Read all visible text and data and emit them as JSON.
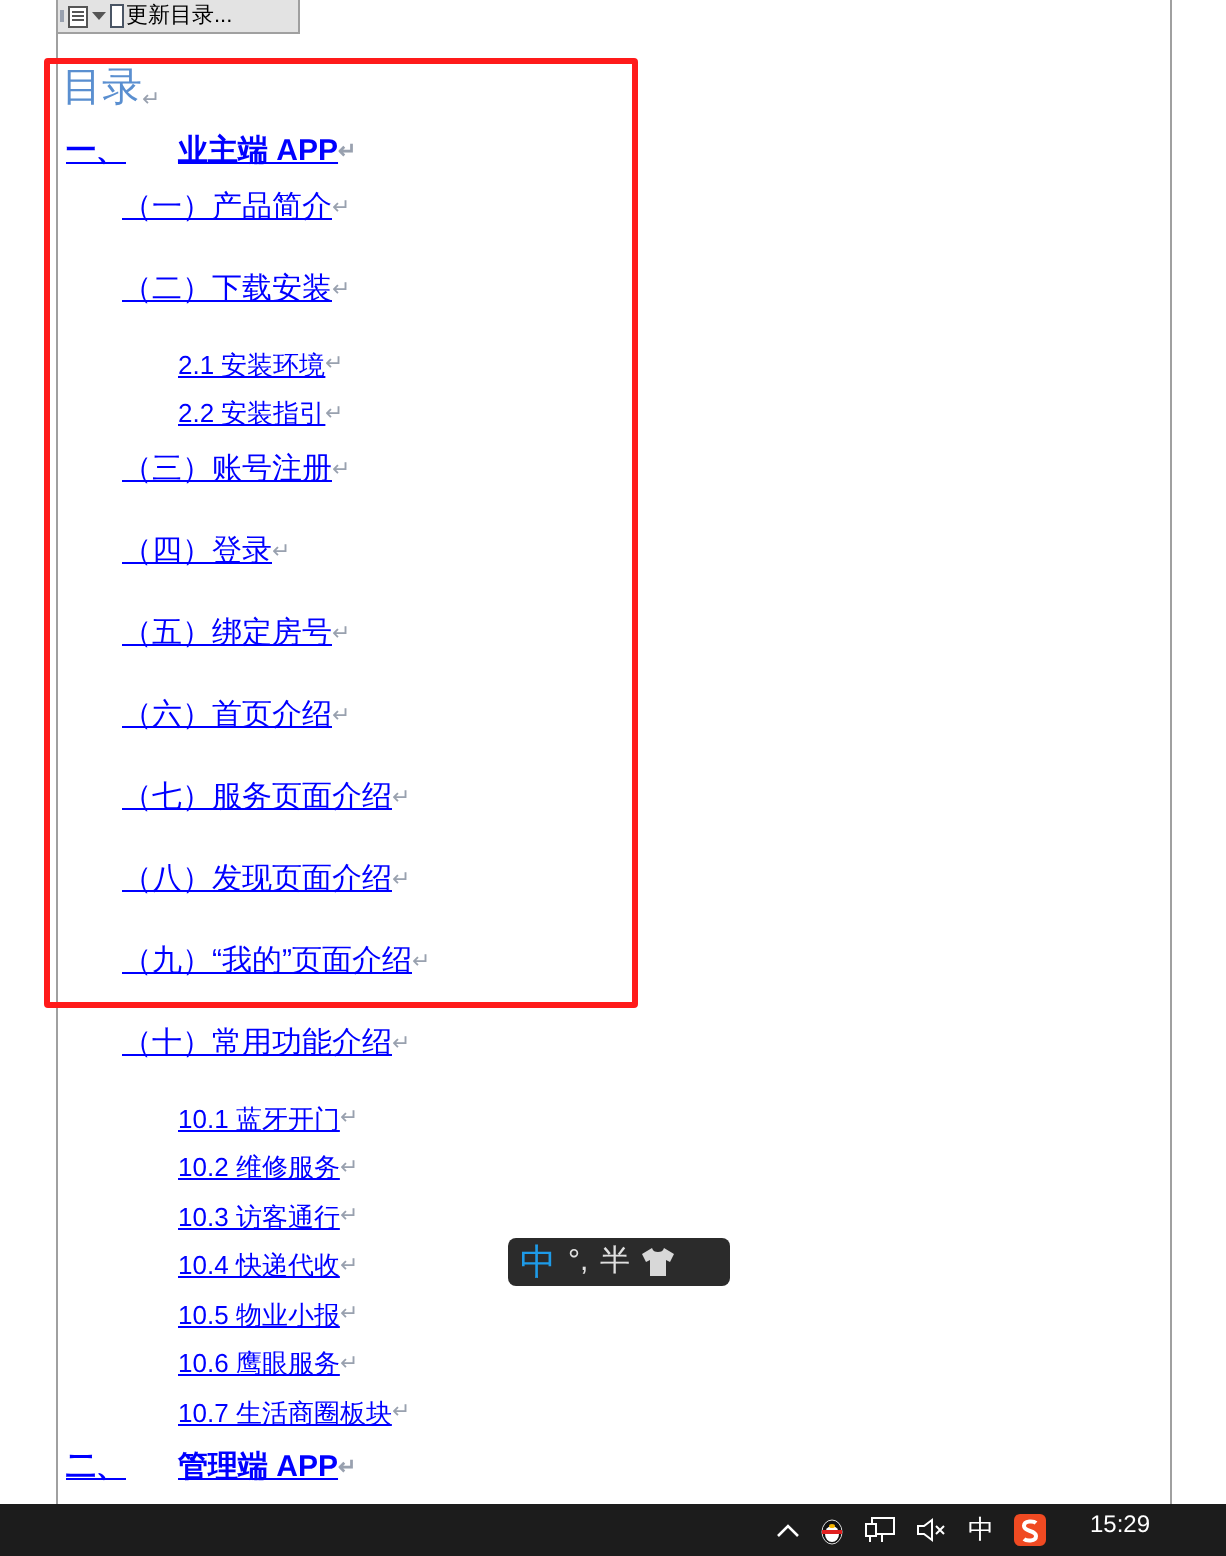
{
  "toolbar": {
    "button": "更新目录..."
  },
  "heading": {
    "text": "目录",
    "mark": "↵"
  },
  "entries": [
    {
      "kind": "level1",
      "number": "一、",
      "text": "业主端 APP",
      "mark": "↵"
    },
    {
      "kind": "level2",
      "text": "（一）产品简介",
      "mark": "↵"
    },
    {
      "kind": "level2",
      "text": "（二）下载安装",
      "mark": "↵"
    },
    {
      "kind": "level3",
      "text": "2.1 安装环境",
      "mark": "↵"
    },
    {
      "kind": "level3",
      "text": "2.2 安装指引",
      "mark": "↵"
    },
    {
      "kind": "level2",
      "text": "（三）账号注册",
      "mark": "↵"
    },
    {
      "kind": "level2",
      "text": "（四）登录",
      "mark": "↵"
    },
    {
      "kind": "level2",
      "text": "（五）绑定房号",
      "mark": "↵"
    },
    {
      "kind": "level2",
      "text": "（六）首页介绍",
      "mark": "↵"
    },
    {
      "kind": "level2",
      "text": "（七）服务页面介绍",
      "mark": "↵"
    },
    {
      "kind": "level2",
      "text": "（八）发现页面介绍",
      "mark": "↵"
    },
    {
      "kind": "level2",
      "text": "（九）“我的”页面介绍",
      "mark": "↵"
    },
    {
      "kind": "level2",
      "text": "（十）常用功能介绍",
      "mark": "↵"
    },
    {
      "kind": "level3",
      "text": "10.1 蓝牙开门",
      "mark": "↵"
    },
    {
      "kind": "level3",
      "text": "10.2 维修服务",
      "mark": "↵"
    },
    {
      "kind": "level3",
      "text": "10.3 访客通行",
      "mark": "↵"
    },
    {
      "kind": "level3",
      "text": "10.4 快递代收",
      "mark": "↵"
    },
    {
      "kind": "level3",
      "text": "10.5 物业小报",
      "mark": "↵"
    },
    {
      "kind": "level3",
      "text": "10.6 鹰眼服务",
      "mark": "↵"
    },
    {
      "kind": "level3",
      "text": "10.7 生活商圈板块",
      "mark": "↵"
    },
    {
      "kind": "level1",
      "number": "二、",
      "text": "管理端 APP",
      "mark": "↵"
    }
  ],
  "ime": {
    "mode": "中",
    "punct": "°,",
    "width": "半"
  },
  "taskbar": {
    "input_indicator": "中",
    "time": "15:29"
  }
}
